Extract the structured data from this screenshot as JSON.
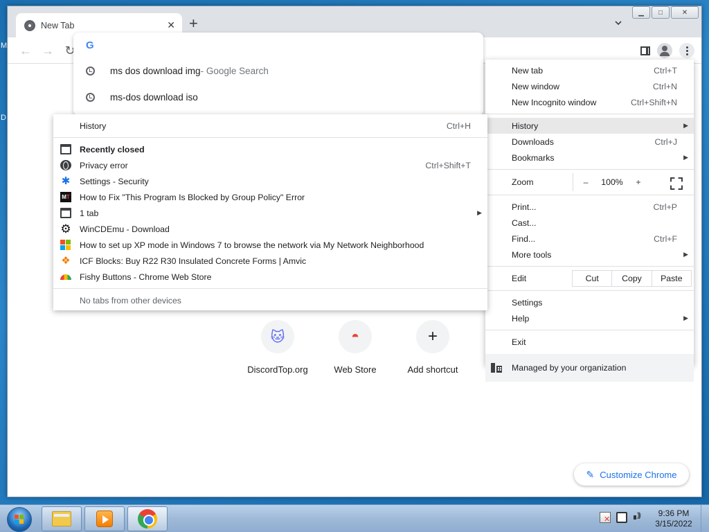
{
  "desktop": {
    "left_glyph_top": "M",
    "left_glyph_mid": "D"
  },
  "tab": {
    "title": "New Tab",
    "close": "✕"
  },
  "newtab": "+",
  "window_controls": {
    "minimize": "▁",
    "maximize": "□",
    "close": "✕"
  },
  "nav": {
    "back": "←",
    "forward": "→",
    "reload": "↻"
  },
  "omnibox": {
    "g": "G",
    "suggestions": [
      {
        "text": "ms dos download img",
        "suffix": " - Google Search"
      },
      {
        "text": "ms-dos download iso",
        "suffix": ""
      }
    ]
  },
  "ntp": {
    "shortcuts": [
      {
        "label": "DiscordTop.org",
        "glyph": "🐱"
      },
      {
        "label": "Web Store",
        "glyph": "◓"
      },
      {
        "label": "Add shortcut",
        "glyph": "+"
      }
    ],
    "customize": "Customize Chrome",
    "pencil": "✎"
  },
  "main_menu": {
    "new_tab": "New tab",
    "new_tab_sc": "Ctrl+T",
    "new_window": "New window",
    "new_window_sc": "Ctrl+N",
    "incognito": "New Incognito window",
    "incognito_sc": "Ctrl+Shift+N",
    "history": "History",
    "downloads": "Downloads",
    "downloads_sc": "Ctrl+J",
    "bookmarks": "Bookmarks",
    "zoom": "Zoom",
    "zoom_minus": "–",
    "zoom_value": "100%",
    "zoom_plus": "+",
    "print": "Print...",
    "print_sc": "Ctrl+P",
    "cast": "Cast...",
    "find": "Find...",
    "find_sc": "Ctrl+F",
    "more_tools": "More tools",
    "edit": "Edit",
    "cut": "Cut",
    "copy": "Copy",
    "paste": "Paste",
    "settings": "Settings",
    "help": "Help",
    "exit": "Exit",
    "managed": "Managed by your organization",
    "arrow": "▶"
  },
  "history_menu": {
    "history": "History",
    "history_sc": "Ctrl+H",
    "recently_closed": "Recently closed",
    "items": [
      {
        "label": "Privacy error",
        "shortcut": "Ctrl+Shift+T",
        "icon": "globe"
      },
      {
        "label": "Settings - Security",
        "shortcut": "",
        "icon": "gear"
      },
      {
        "label": "How to Fix \"This Program Is Blocked by Group Policy\" Error",
        "shortcut": "",
        "icon": "mt"
      },
      {
        "label": "1 tab",
        "shortcut": "",
        "icon": "window"
      },
      {
        "label": "WinCDEmu - Download",
        "shortcut": "",
        "icon": "cog"
      },
      {
        "label": "How to set up XP mode in Windows 7 to browse the network via My Network Neighborhood",
        "shortcut": "",
        "icon": "ms"
      },
      {
        "label": "ICF Blocks: Buy R22  R30 Insulated Concrete Forms | Amvic",
        "shortcut": "",
        "icon": "amvic"
      },
      {
        "label": "Fishy Buttons - Chrome Web Store",
        "shortcut": "",
        "icon": "fishy"
      }
    ],
    "no_tabs": "No tabs from other devices",
    "mt_M": "M",
    "mt_T": "T",
    "gear_glyph": "✱",
    "cog_glyph": "⚙",
    "amvic_glyph": "❖",
    "arrow": "▶"
  },
  "taskbar": {
    "time": "9:36 PM",
    "date": "3/15/2022"
  }
}
